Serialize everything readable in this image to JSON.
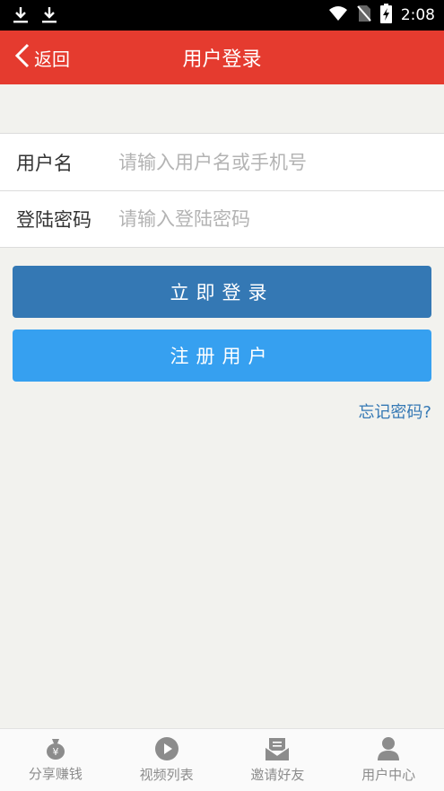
{
  "status_bar": {
    "time": "2:08",
    "icons": [
      "download-icon",
      "download-icon",
      "wifi-icon",
      "no-sim-icon",
      "battery-charging-icon"
    ]
  },
  "header": {
    "back_label": "返回",
    "title": "用户登录"
  },
  "form": {
    "username": {
      "label": "用户名",
      "placeholder": "请输入用户名或手机号",
      "value": ""
    },
    "password": {
      "label": "登陆密码",
      "placeholder": "请输入登陆密码",
      "value": ""
    }
  },
  "actions": {
    "login_label": "立即登录",
    "register_label": "注册用户",
    "forgot_label": "忘记密码?"
  },
  "tabbar": {
    "items": [
      {
        "label": "分享赚钱",
        "icon": "money-bag-icon"
      },
      {
        "label": "视频列表",
        "icon": "play-icon"
      },
      {
        "label": "邀请好友",
        "icon": "envelope-icon"
      },
      {
        "label": "用户中心",
        "icon": "user-icon"
      }
    ]
  },
  "colors": {
    "header_bg": "#e53b2f",
    "login_btn": "#3478b4",
    "register_btn": "#36a0f0",
    "link": "#3478b4",
    "tab_icon": "#8c8c8c"
  }
}
